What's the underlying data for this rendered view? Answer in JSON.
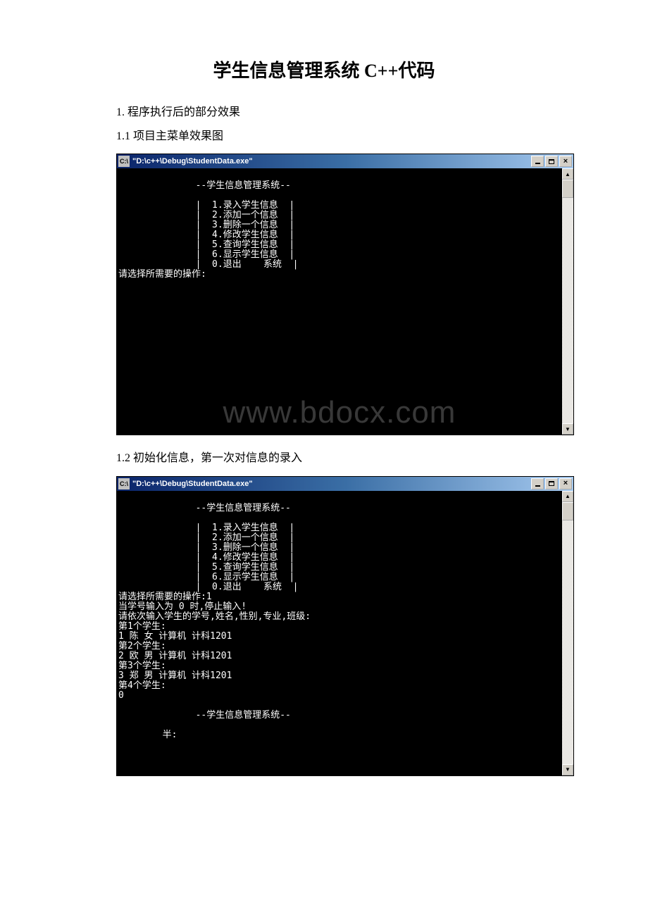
{
  "title": "学生信息管理系统 C++代码",
  "section1": "1. 程序执行后的部分效果",
  "section1_1": "1.1 项目主菜单效果图",
  "section1_2": "1.2 初始化信息，第一次对信息的录入",
  "window_title": "\"D:\\c++\\Debug\\StudentData.exe\"",
  "watermark": "www.bdocx.com",
  "win_btns": {
    "min_name": "minimize-icon",
    "max_name": "maximize-icon",
    "close_label": "×"
  },
  "console1": {
    "header": "              --学生信息管理系统--",
    "menu": [
      "              |  1.录入学生信息  |",
      "              |  2.添加一个信息  |",
      "              |  3.删除一个信息  |",
      "              |  4.修改学生信息  |",
      "              |  5.查询学生信息  |",
      "              |  6.显示学生信息  |",
      "              |  0.退出    系统  |"
    ],
    "prompt": "请选择所需要的操作:"
  },
  "console2": {
    "header": "              --学生信息管理系统--",
    "menu": [
      "              |  1.录入学生信息  |",
      "              |  2.添加一个信息  |",
      "              |  3.删除一个信息  |",
      "              |  4.修改学生信息  |",
      "              |  5.查询学生信息  |",
      "              |  6.显示学生信息  |",
      "              |  0.退出    系统  |"
    ],
    "prompt_sel": "请选择所需要的操作:1",
    "hint1": "当学号输入为 0 时,停止输入!",
    "hint2": "请依次输入学生的学号,姓名,性别,专业,班级:",
    "s1_label": "第1个学生:",
    "s1_data": "1 陈 女 计算机 计科1201",
    "s2_label": "第2个学生:",
    "s2_data": "2 欧 男 计算机 计科1201",
    "s3_label": "第3个学生:",
    "s3_data": "3 郑 男 计算机 计科1201",
    "s4_label": "第4个学生:",
    "s4_data": "0",
    "footer": "              --学生信息管理系统--",
    "partial": "        半:"
  }
}
